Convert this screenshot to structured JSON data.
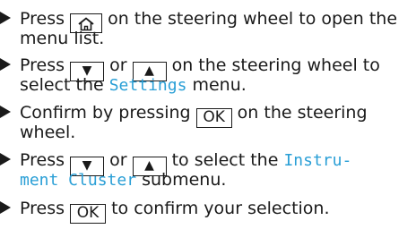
{
  "colors": {
    "text": "#1a1a1a",
    "display_text": "#2a9fd6"
  },
  "icons": {
    "bullet": "triangle-bullet-icon",
    "home_key": "home-icon",
    "down_key": "down-triangle-icon",
    "up_key": "up-triangle-icon"
  },
  "steps": [
    {
      "line1_before": "Press ",
      "line1_after": " on the steering wheel to open the",
      "line2": "menu list."
    },
    {
      "line1_before": "Press ",
      "line1_or": " or ",
      "line1_after": " on the steering wheel to",
      "line2_before": "select the ",
      "display": "Settings",
      "line2_after": " menu."
    },
    {
      "line1_before": "Confirm by pressing ",
      "key": "OK",
      "line1_after": " on the steering",
      "line2": "wheel."
    },
    {
      "line1_before": "Press ",
      "line1_or": " or ",
      "line1_after": " to select the ",
      "display1": "Instru-",
      "display2": "ment Cluster",
      "line2_after": " submenu."
    },
    {
      "line1_before": "Press ",
      "key": "OK",
      "line1_after": " to confirm your selection."
    }
  ],
  "keys": {
    "down": "▼",
    "up": "▲"
  }
}
